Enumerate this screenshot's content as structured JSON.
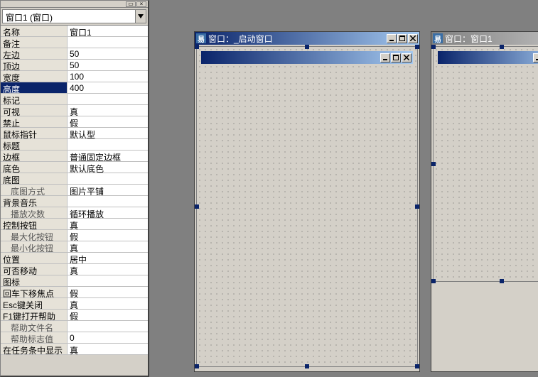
{
  "dropdown": {
    "selected": "窗口1 (窗口)"
  },
  "props": [
    {
      "label": "名称",
      "value": "窗口1"
    },
    {
      "label": "备注",
      "value": ""
    },
    {
      "label": "左边",
      "value": "50"
    },
    {
      "label": "顶边",
      "value": "50"
    },
    {
      "label": "宽度",
      "value": "100"
    },
    {
      "label": "高度",
      "value": "400",
      "selected": true
    },
    {
      "label": "标记",
      "value": ""
    },
    {
      "label": "可视",
      "value": "真"
    },
    {
      "label": "禁止",
      "value": "假"
    },
    {
      "label": "鼠标指针",
      "value": "默认型"
    },
    {
      "label": "标题",
      "value": ""
    },
    {
      "label": "边框",
      "value": "普通固定边框"
    },
    {
      "label": "底色",
      "value": "默认底色"
    },
    {
      "label": "底图",
      "value": ""
    },
    {
      "label": "底图方式",
      "value": "图片平铺",
      "indent": true
    },
    {
      "label": "背景音乐",
      "value": ""
    },
    {
      "label": "播放次数",
      "value": "循环播放",
      "indent": true
    },
    {
      "label": "控制按钮",
      "value": "真"
    },
    {
      "label": "最大化按钮",
      "value": "假",
      "indent": true
    },
    {
      "label": "最小化按钮",
      "value": "真",
      "indent": true
    },
    {
      "label": "位置",
      "value": "居中"
    },
    {
      "label": "可否移动",
      "value": "真"
    },
    {
      "label": "图标",
      "value": ""
    },
    {
      "label": "回车下移焦点",
      "value": "假"
    },
    {
      "label": "Esc键关闭",
      "value": "真"
    },
    {
      "label": "F1键打开帮助",
      "value": "假"
    },
    {
      "label": "帮助文件名",
      "value": "",
      "indent": true
    },
    {
      "label": "帮助标志值",
      "value": "0",
      "indent": true
    },
    {
      "label": "在任务条中显示",
      "value": "真"
    }
  ],
  "windows": {
    "left": {
      "iconChar": "易",
      "title": "窗口：_启动窗口"
    },
    "right": {
      "iconChar": "易",
      "title": "窗口：窗口1"
    }
  }
}
